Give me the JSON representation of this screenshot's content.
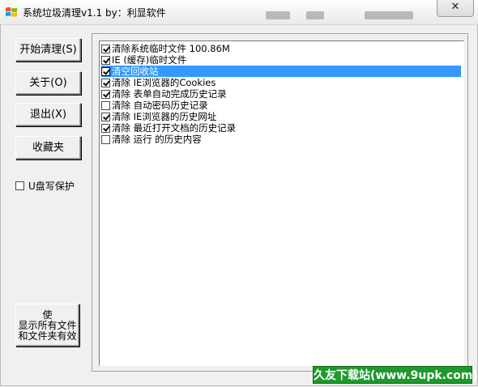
{
  "window": {
    "title": "系统垃圾清理v1.1  by：利显软件",
    "close_label": "✕"
  },
  "buttons": {
    "start_clean": "开始清理(S)",
    "about": "关于(O)",
    "exit": "退出(X)",
    "favorites": "收藏夹",
    "show_all_line1": "使",
    "show_all_line2": "显示所有文件",
    "show_all_line3": "和文件夹有效"
  },
  "write_protect": {
    "label": "U盘写保护",
    "checked": false
  },
  "clean_items": [
    {
      "label": "清除系统临时文件    100.86M",
      "checked": true,
      "selected": false
    },
    {
      "label": "IE (缓存)临时文件",
      "checked": true,
      "selected": false
    },
    {
      "label": "清空回收站",
      "checked": true,
      "selected": true
    },
    {
      "label": "清除 IE浏览器的Cookies",
      "checked": true,
      "selected": false
    },
    {
      "label": "清除 表单自动完成历史记录",
      "checked": true,
      "selected": false
    },
    {
      "label": "清除 自动密码历史记录",
      "checked": false,
      "selected": false
    },
    {
      "label": "清除 IE浏览器的历史网址",
      "checked": true,
      "selected": false
    },
    {
      "label": "清除 最近打开文档的历史记录",
      "checked": true,
      "selected": false
    },
    {
      "label": "清除 运行 的历史内容",
      "checked": false,
      "selected": false
    }
  ],
  "watermark": "久友下载站(www.9upk.com)",
  "colors": {
    "selection": "#3399ff",
    "watermark_bg": "#1c9a2c"
  }
}
